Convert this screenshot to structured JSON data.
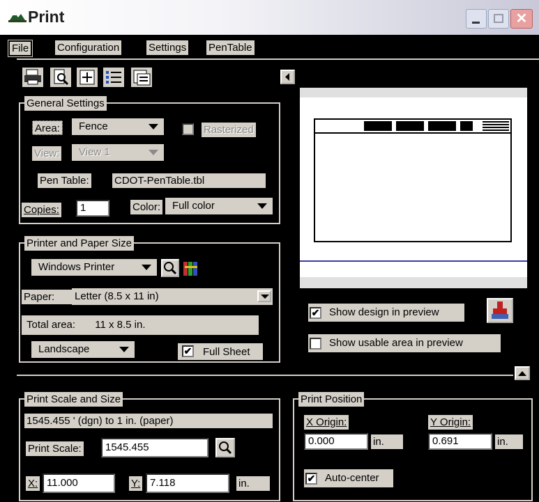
{
  "window": {
    "title": "Print",
    "controls": {
      "minimize": "_",
      "maximize": "□",
      "close": "✕"
    }
  },
  "menu": {
    "items": [
      "File",
      "Configuration",
      "Settings",
      "PenTable"
    ]
  },
  "toolbar": {
    "icons": [
      "printer-icon",
      "preview-icon",
      "maximize-area-icon",
      "list-icon",
      "properties-icon"
    ]
  },
  "general": {
    "title": "General Settings",
    "area_label": "Area:",
    "area_value": "Fence",
    "rasterized_label": "Rasterized",
    "view_label": "View:",
    "view_value": "View 1",
    "pen_table_label": "Pen Table:",
    "pen_table_value": "CDOT-PenTable.tbl",
    "copies_label": "Copies:",
    "copies_value": "1",
    "color_label": "Color:",
    "color_value": "Full color"
  },
  "printer": {
    "title": "Printer and Paper Size",
    "printer_value": "Windows Printer",
    "paper_label": "Paper:",
    "paper_value": "Letter (8.5 x 11 in)",
    "total_area_label": "Total area:",
    "total_area_value": "11 x 8.5 in.",
    "orientation_value": "Landscape",
    "full_sheet_label": "Full Sheet",
    "full_sheet_checked": true
  },
  "preview": {
    "show_design_label": "Show design in preview",
    "show_design_checked": true,
    "show_usable_label": "Show usable area in preview",
    "show_usable_checked": false
  },
  "scale": {
    "title": "Print Scale and Size",
    "ratio_text": "1545.455 ' (dgn) to 1 in. (paper)",
    "print_scale_label": "Print Scale:",
    "print_scale_value": "1545.455",
    "x_label": "X:",
    "x_value": "11.000",
    "y_label": "Y:",
    "y_value": "7.118",
    "unit": "in."
  },
  "position": {
    "title": "Print Position",
    "x_origin_label": "X Origin:",
    "x_origin_value": "0.000",
    "y_origin_label": "Y Origin:",
    "y_origin_value": "0.691",
    "unit": "in.",
    "auto_center_label": "Auto-center",
    "auto_center_checked": true
  },
  "colors": {
    "title_bar_start": "#ffffff",
    "title_bar_end": "#d8d8e8",
    "panel": "#d4d0c8",
    "close_button": "#e04848"
  }
}
